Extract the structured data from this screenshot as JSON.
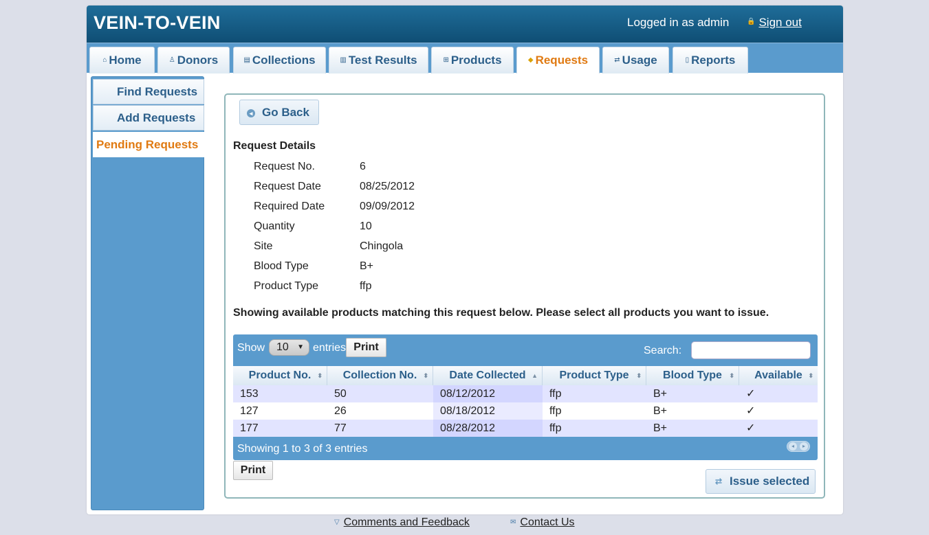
{
  "header": {
    "app_title": "VEIN-TO-VEIN",
    "logged_in": "Logged in as admin",
    "sign_out": "Sign out"
  },
  "nav": {
    "tabs": [
      {
        "label": "Home",
        "icon": "home-icon"
      },
      {
        "label": "Donors",
        "icon": "person-icon"
      },
      {
        "label": "Collections",
        "icon": "box-icon"
      },
      {
        "label": "Test Results",
        "icon": "chart-icon"
      },
      {
        "label": "Products",
        "icon": "cart-icon"
      },
      {
        "label": "Requests",
        "icon": "tag-icon"
      },
      {
        "label": "Usage",
        "icon": "swap-icon"
      },
      {
        "label": "Reports",
        "icon": "clipboard-icon"
      }
    ],
    "active": "Requests"
  },
  "sidebar": {
    "items": [
      {
        "label": "Find Requests"
      },
      {
        "label": "Add Requests"
      },
      {
        "label": "Pending Requests"
      }
    ],
    "active": "Pending Requests"
  },
  "main": {
    "go_back": "Go Back",
    "section_title": "Request Details",
    "details": [
      {
        "label": "Request No.",
        "value": "6"
      },
      {
        "label": "Request Date",
        "value": "08/25/2012"
      },
      {
        "label": "Required Date",
        "value": "09/09/2012"
      },
      {
        "label": "Quantity",
        "value": "10"
      },
      {
        "label": "Site",
        "value": "Chingola"
      },
      {
        "label": "Blood Type",
        "value": "B+"
      },
      {
        "label": "Product Type",
        "value": "ffp"
      }
    ],
    "instruction": "Showing available products matching this request below. Please select all products you want to issue.",
    "table": {
      "show_label": "Show",
      "page_size": "10",
      "entries_label": "entries",
      "print_label": "Print",
      "search_label": "Search:",
      "search_value": "",
      "columns": [
        "Product No.",
        "Collection No.",
        "Date Collected",
        "Product Type",
        "Blood Type",
        "Available"
      ],
      "sorted_column": "Date Collected",
      "rows": [
        [
          "153",
          "50",
          "08/12/2012",
          "ffp",
          "B+",
          "✓"
        ],
        [
          "127",
          "26",
          "08/18/2012",
          "ffp",
          "B+",
          "✓"
        ],
        [
          "177",
          "77",
          "08/28/2012",
          "ffp",
          "B+",
          "✓"
        ]
      ],
      "info": "Showing 1 to 3 of 3 entries"
    },
    "print_bottom": "Print",
    "issue_selected": "Issue selected"
  },
  "footer": {
    "feedback": "Comments and Feedback",
    "contact": "Contact Us"
  },
  "colors": {
    "header_bg": "#0f4e74",
    "nav_bg": "#5a9bcd",
    "active_accent": "#e07a12",
    "link_blue": "#2c5f8a",
    "row_odd": "#e2e4ff"
  }
}
